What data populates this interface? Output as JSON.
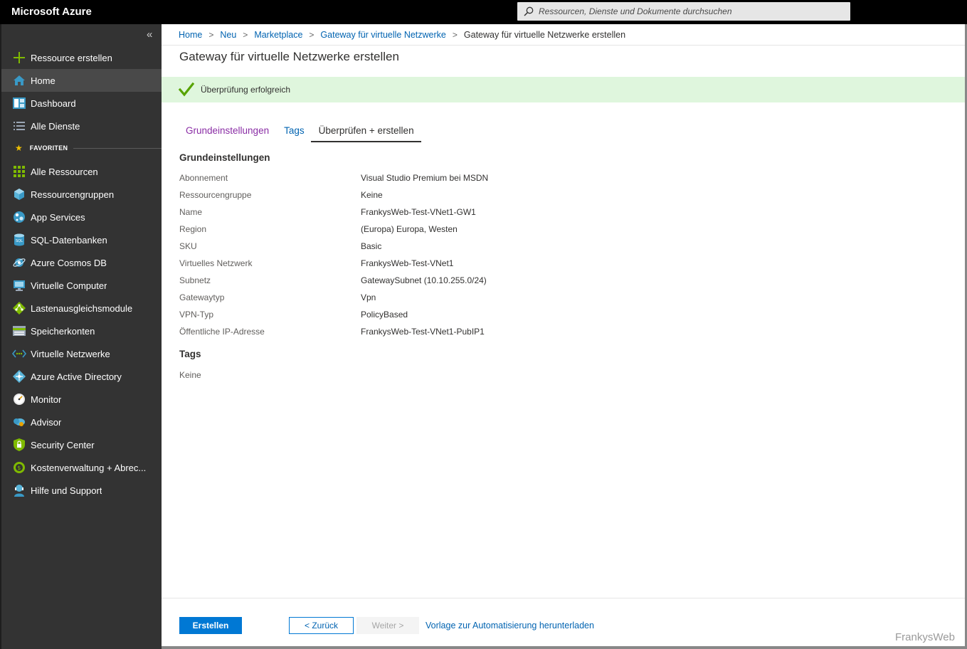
{
  "app": {
    "title": "Microsoft Azure"
  },
  "search": {
    "placeholder": "Ressourcen, Dienste und Dokumente durchsuchen"
  },
  "sidebar": {
    "collapse_label": "«",
    "items": [
      {
        "label": "Ressource erstellen",
        "icon": "plus-icon"
      },
      {
        "label": "Home",
        "icon": "home-icon",
        "active": true
      },
      {
        "label": "Dashboard",
        "icon": "dashboard-icon"
      },
      {
        "label": "Alle Dienste",
        "icon": "list-icon"
      }
    ],
    "favorites_label": "FAVORITEN",
    "favorites": [
      {
        "label": "Alle Ressourcen",
        "icon": "grid-icon"
      },
      {
        "label": "Ressourcengruppen",
        "icon": "cube-icon"
      },
      {
        "label": "App Services",
        "icon": "app-services-icon"
      },
      {
        "label": "SQL-Datenbanken",
        "icon": "sql-icon"
      },
      {
        "label": "Azure Cosmos DB",
        "icon": "cosmos-icon"
      },
      {
        "label": "Virtuelle Computer",
        "icon": "monitor-icon"
      },
      {
        "label": "Lastenausgleichsmodule",
        "icon": "load-balancer-icon"
      },
      {
        "label": "Speicherkonten",
        "icon": "storage-icon"
      },
      {
        "label": "Virtuelle Netzwerke",
        "icon": "vnet-icon"
      },
      {
        "label": "Azure Active Directory",
        "icon": "aad-icon"
      },
      {
        "label": "Monitor",
        "icon": "gauge-icon"
      },
      {
        "label": "Advisor",
        "icon": "advisor-icon"
      },
      {
        "label": "Security Center",
        "icon": "shield-icon"
      },
      {
        "label": "Kostenverwaltung + Abrec...",
        "icon": "cost-icon"
      },
      {
        "label": "Hilfe und Support",
        "icon": "support-icon"
      }
    ]
  },
  "breadcrumb": {
    "items": [
      "Home",
      "Neu",
      "Marketplace",
      "Gateway für virtuelle Netzwerke"
    ],
    "current": "Gateway für virtuelle Netzwerke erstellen",
    "separator": ">"
  },
  "page": {
    "title": "Gateway für virtuelle Netzwerke erstellen",
    "validation": "Überprüfung erfolgreich",
    "tabs": [
      "Grundeinstellungen",
      "Tags",
      "Überprüfen + erstellen"
    ],
    "active_tab": "Überprüfen + erstellen"
  },
  "basics": {
    "heading": "Grundeinstellungen",
    "rows": [
      {
        "key": "Abonnement",
        "value": "Visual Studio Premium bei MSDN"
      },
      {
        "key": "Ressourcengruppe",
        "value": "Keine"
      },
      {
        "key": "Name",
        "value": "FrankysWeb-Test-VNet1-GW1"
      },
      {
        "key": "Region",
        "value": "(Europa) Europa, Westen"
      },
      {
        "key": "SKU",
        "value": "Basic"
      },
      {
        "key": "Virtuelles Netzwerk",
        "value": "FrankysWeb-Test-VNet1"
      },
      {
        "key": "Subnetz",
        "value": "GatewaySubnet (10.10.255.0/24)"
      },
      {
        "key": "Gatewaytyp",
        "value": "Vpn"
      },
      {
        "key": "VPN-Typ",
        "value": "PolicyBased"
      },
      {
        "key": "Öffentliche IP-Adresse",
        "value": "FrankysWeb-Test-VNet1-PubIP1"
      }
    ]
  },
  "tags": {
    "heading": "Tags",
    "value": "Keine"
  },
  "footer": {
    "create_label": "Erstellen",
    "back_label": "< Zurück",
    "next_label": "Weiter >",
    "download_label": "Vorlage zur Automatisierung herunterladen"
  },
  "watermark": "FrankysWeb",
  "colors": {
    "accent": "#0078d4",
    "success_bg": "#dff6dd",
    "success_check": "#57a300",
    "sidebar_bg": "#333333"
  }
}
